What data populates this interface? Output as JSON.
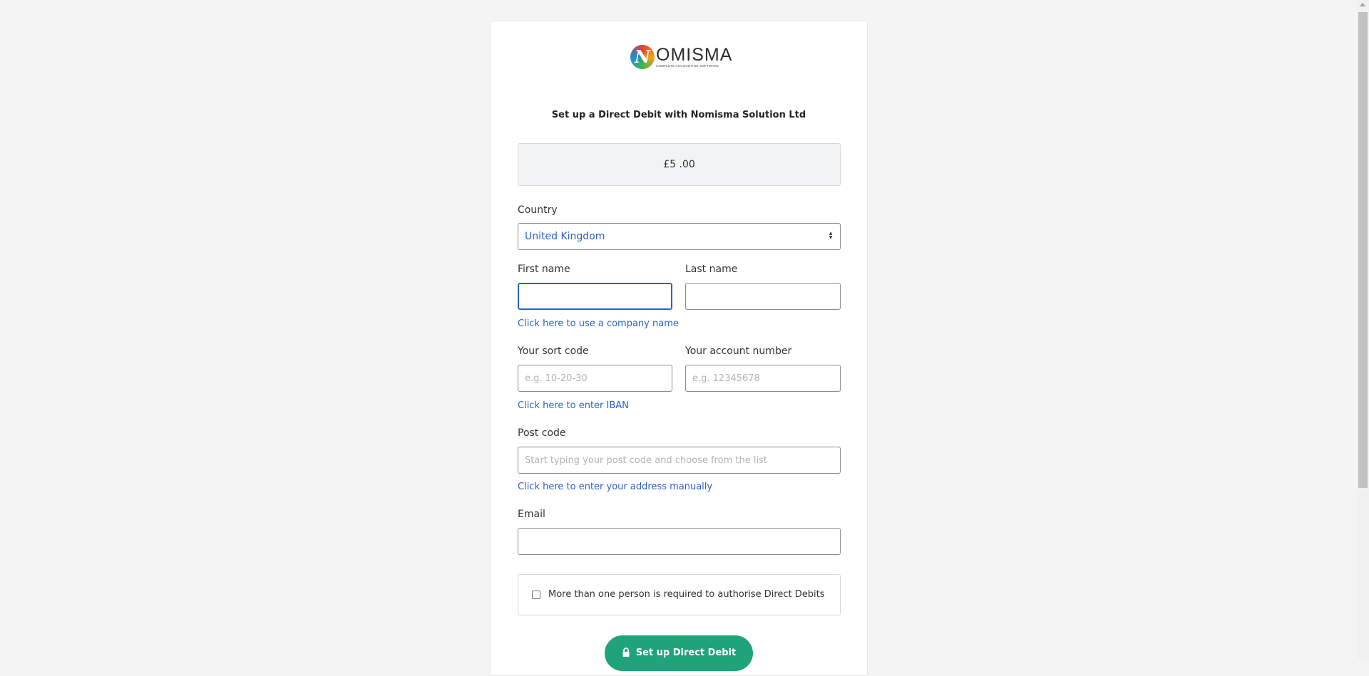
{
  "logo": {
    "mark_letter": "N",
    "word": "OMISMA",
    "tagline": "COMPLETE ACCOUNTING SOFTWARE"
  },
  "heading": "Set up a Direct Debit with Nomisma Solution Ltd",
  "amount": "£5 .00",
  "country": {
    "label": "Country",
    "value": "United Kingdom"
  },
  "first_name": {
    "label": "First name",
    "value": "",
    "placeholder": ""
  },
  "last_name": {
    "label": "Last name",
    "value": "",
    "placeholder": ""
  },
  "company_link": "Click here to use a company name",
  "sort_code": {
    "label": "Your sort code",
    "placeholder": "e.g. 10-20-30"
  },
  "account_number": {
    "label": "Your account number",
    "placeholder": "e.g. 12345678"
  },
  "iban_link": "Click here to enter IBAN",
  "post_code": {
    "label": "Post code",
    "placeholder": "Start typing your post code and choose from the list"
  },
  "address_link": "Click here to enter your address manually",
  "email": {
    "label": "Email",
    "placeholder": ""
  },
  "authorise": {
    "text": "More than one person is required to authorise Direct Debits",
    "checked": false
  },
  "submit": {
    "label": "Set up Direct Debit",
    "icon": "lock-icon"
  },
  "colors": {
    "accent": "#2b62c2",
    "button": "#1fa47a",
    "background": "#f4f4f4"
  }
}
